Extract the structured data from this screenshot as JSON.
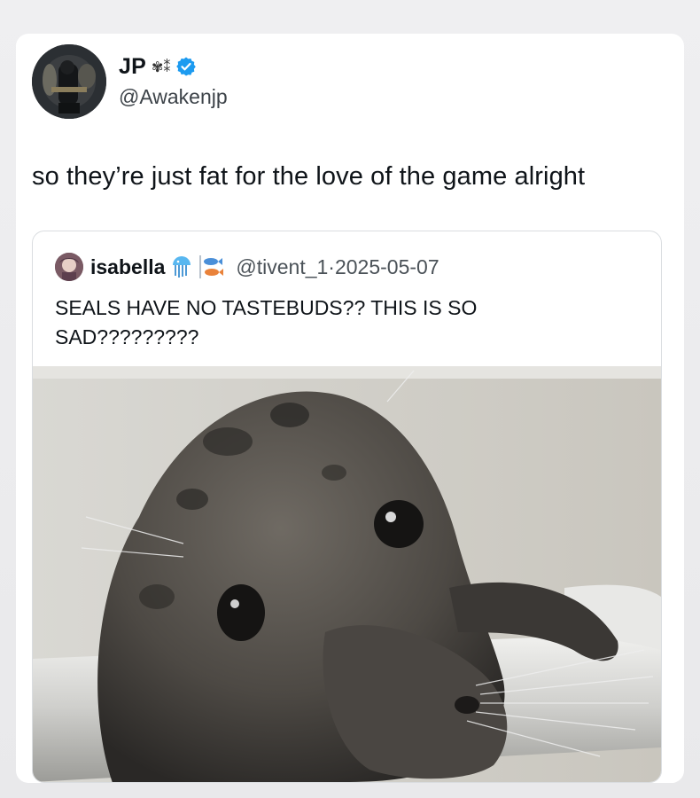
{
  "tweet": {
    "author_name": "JP",
    "author_glyphs": "✾⁑",
    "verified_icon": "verified-badge-icon",
    "handle": "@Awakenjp",
    "text": "so they’re just fat for the love of the game alright"
  },
  "quoted_tweet": {
    "author_name": "isabella",
    "handle_date": "@tivent_1·2025-05-07",
    "text": "SEALS HAVE NO TASTEBUDS?? THIS IS SO SAD?????????",
    "emoji_icons": [
      "jellyfish-icon",
      "fish-icon"
    ],
    "image": "seal-photo"
  },
  "colors": {
    "verified": "#1d9bf0",
    "text": "#0f1419",
    "secondary": "#4b5258"
  }
}
